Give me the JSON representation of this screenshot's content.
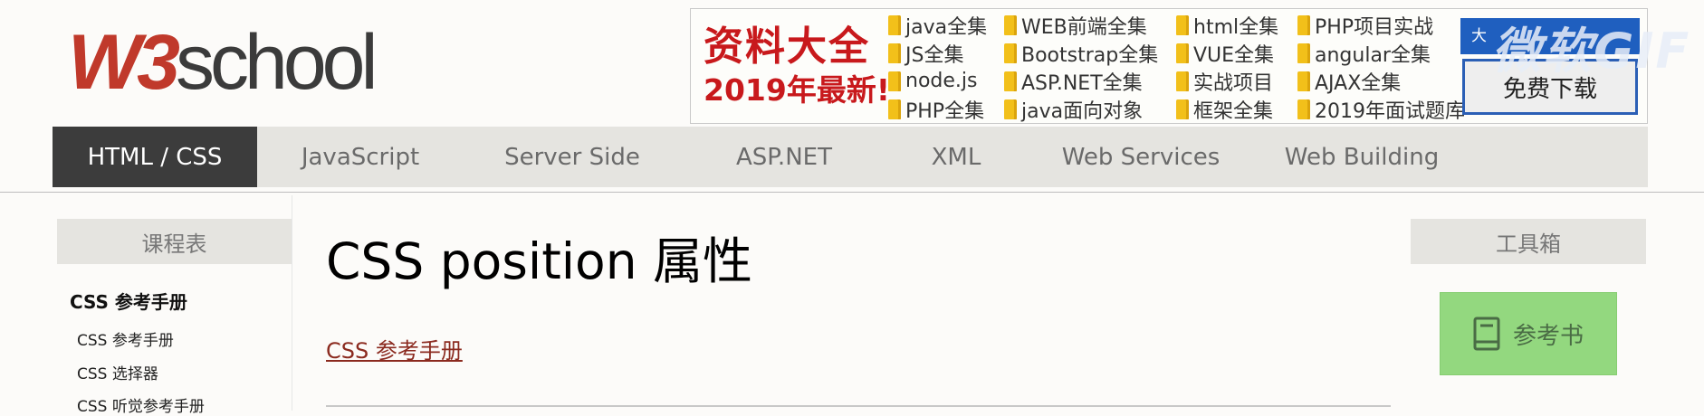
{
  "header": {
    "logo_w3": "W3",
    "logo_rest": "school"
  },
  "ad": {
    "headline_line1": "资料大全",
    "headline_line2": "2019年最新!",
    "links": [
      "java全集",
      "WEB前端全集",
      "html全集",
      "PHP项目实战",
      "JS全集",
      "Bootstrap全集",
      "VUE全集",
      "angular全集",
      "node.js",
      "ASP.NET全集",
      "实战项目",
      "AJAX全集",
      "PHP全集",
      "java面向对象",
      "框架全集",
      "2019年面试题库"
    ],
    "download_banner": "大",
    "download_button": "免费下载",
    "watermark": "微软GIF"
  },
  "nav": {
    "items": [
      "HTML / CSS",
      "JavaScript",
      "Server Side",
      "ASP.NET",
      "XML",
      "Web Services",
      "Web Building"
    ],
    "active": "HTML / CSS"
  },
  "sidebar": {
    "heading": "课程表",
    "section_title": "CSS 参考手册",
    "items": [
      "CSS 参考手册",
      "CSS 选择器",
      "CSS 听觉参考手册"
    ]
  },
  "main": {
    "title": "CSS position 属性",
    "ref_link": "CSS 参考手册"
  },
  "toolbox": {
    "heading": "工具箱",
    "button_label": "参考书",
    "button_color": "#93d87f"
  }
}
